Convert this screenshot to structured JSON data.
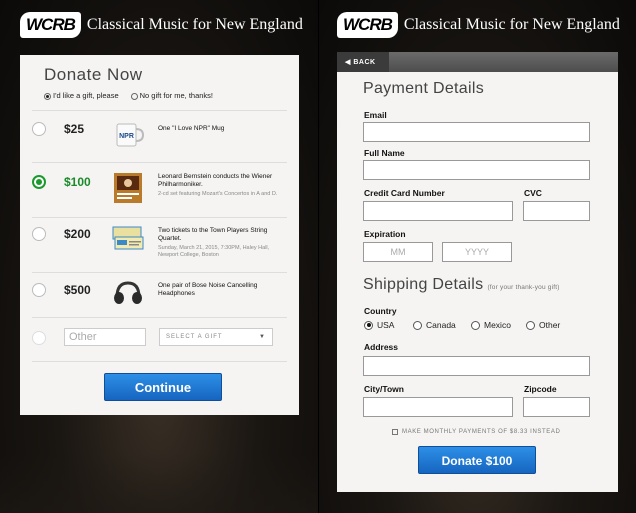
{
  "brand": {
    "logo": "WCRB",
    "tagline": "Classical Music for New England"
  },
  "donate": {
    "title": "Donate Now",
    "gift_yes": "I'd like a gift, please",
    "gift_no": "No gift for me, thanks!",
    "options": [
      {
        "amount": "$25",
        "desc": "One \"I Love NPR\" Mug",
        "sub": "",
        "selected": false,
        "thumb": "mug"
      },
      {
        "amount": "$100",
        "desc": "Leonard Bernstein conducts the Wiener Philharmoniker.",
        "sub": "2-cd set featuring Mozart's Concertos in A and D.",
        "selected": true,
        "thumb": "cd"
      },
      {
        "amount": "$200",
        "desc": "Two tickets to the Town Players String Quartet.",
        "sub": "Sunday, March 21, 2015, 7:30PM, Haley Hall, Newport College, Boston",
        "selected": false,
        "thumb": "tickets"
      },
      {
        "amount": "$500",
        "desc": "One pair of Bose Noise Cancelling Headphones",
        "sub": "",
        "selected": false,
        "thumb": "headphones"
      }
    ],
    "other_placeholder": "Other",
    "select_gift": "SELECT A GIFT",
    "continue": "Continue",
    "accent_green": "#1a8a2a",
    "accent_blue": "#1e7ad4"
  },
  "payment": {
    "back": "BACK",
    "title": "Payment Details",
    "email_label": "Email",
    "fullname_label": "Full Name",
    "cc_label": "Credit Card Number",
    "cvc_label": "CVC",
    "expiration_label": "Expiration",
    "mm_placeholder": "MM",
    "yyyy_placeholder": "YYYY",
    "shipping_title": "Shipping Details",
    "shipping_note": "(for your thank-you gift)",
    "country_label": "Country",
    "countries": [
      "USA",
      "Canada",
      "Mexico",
      "Other"
    ],
    "selected_country": "USA",
    "address_label": "Address",
    "city_label": "City/Town",
    "zip_label": "Zipcode",
    "monthly": "MAKE MONTHLY PAYMENTS OF $8.33 INSTEAD",
    "submit": "Donate $100"
  }
}
